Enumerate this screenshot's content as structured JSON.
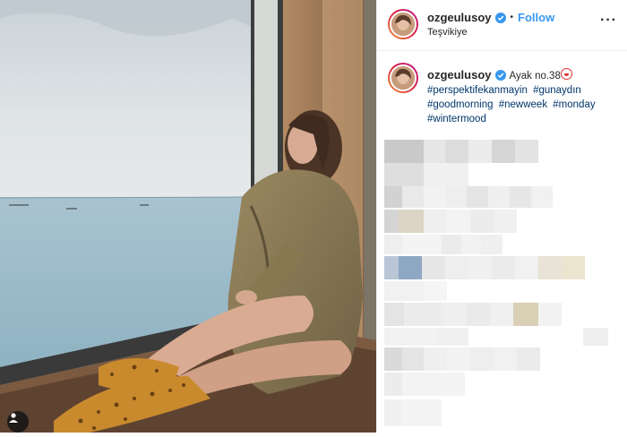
{
  "post": {
    "username": "ozgeulusoy",
    "location": "Teşvikiye",
    "follow_label": "Follow",
    "dot": "•",
    "more": "···"
  },
  "caption": {
    "username": "ozgeulusoy",
    "text": "Ayak no.38",
    "hashtags": [
      "#perspektifekanmayin",
      "#gunaydın",
      "#goodmorning",
      "#newweek",
      "#monday",
      "#wintermood"
    ]
  },
  "icons": {
    "verified": "verified-badge-icon",
    "tag": "user-tag-icon",
    "emoji": "clown-face-icon"
  },
  "colors": {
    "accent": "#3897f0",
    "hashtag": "#003569",
    "verified": "#3897f0",
    "border": "#efefef"
  }
}
